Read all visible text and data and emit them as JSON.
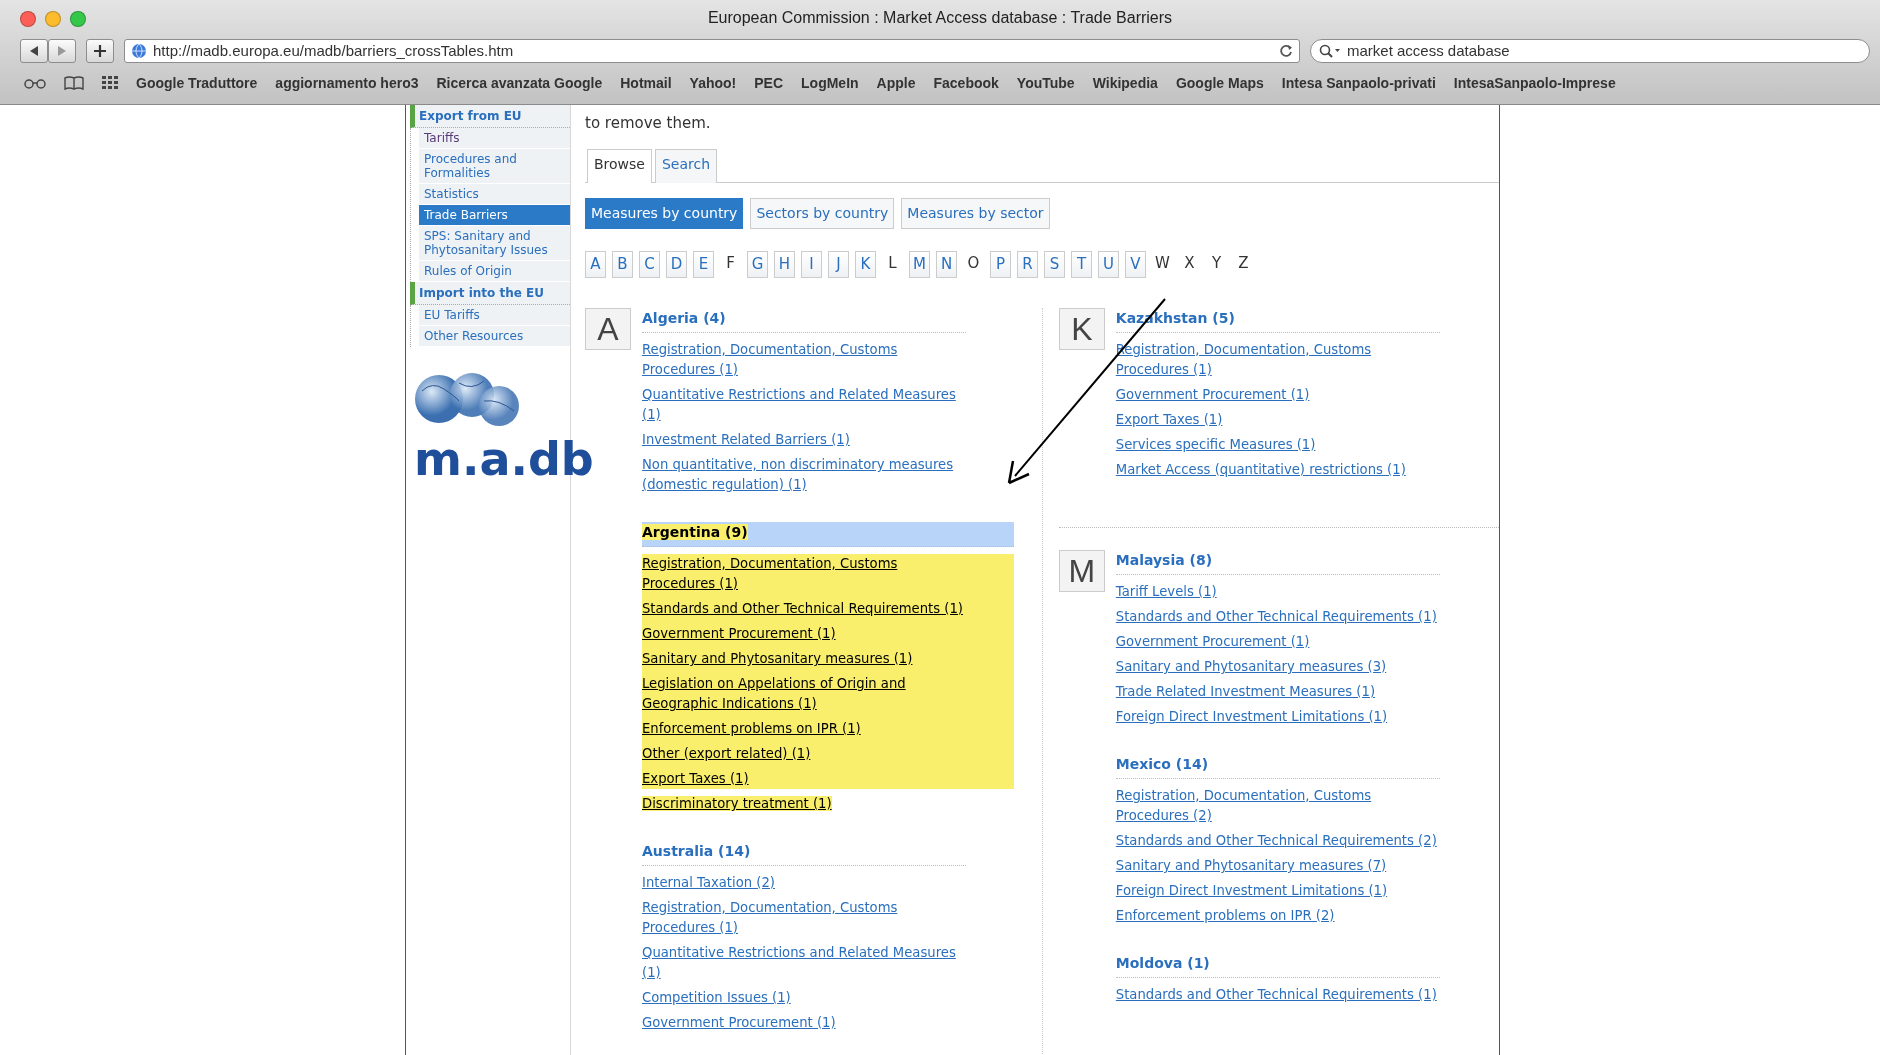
{
  "window": {
    "title": "European Commission : Market Access database : Trade Barriers"
  },
  "toolbar": {
    "url": "http://madb.europa.eu/madb/barriers_crossTables.htm",
    "search": "market access database"
  },
  "bookmarks": [
    "Google Traduttore",
    "aggiornamento hero3",
    "Ricerca avanzata Google",
    "Hotmail",
    "Yahoo!",
    "PEC",
    "LogMeIn",
    "Apple",
    "Facebook",
    "YouTube",
    "Wikipedia",
    "Google Maps",
    "Intesa Sanpaolo-privati",
    "IntesaSanpaolo-Imprese"
  ],
  "sidebar": {
    "sections": [
      {
        "title": "Export from EU",
        "items": [
          {
            "label": "Tariffs",
            "selected": false,
            "visited": true
          },
          {
            "label": "Procedures and Formalities",
            "selected": false,
            "visited": false
          },
          {
            "label": "Statistics",
            "selected": false,
            "visited": false
          },
          {
            "label": "Trade Barriers",
            "selected": true,
            "visited": false
          },
          {
            "label": "SPS: Sanitary and Phytosanitary Issues",
            "selected": false,
            "visited": false
          },
          {
            "label": "Rules of Origin",
            "selected": false,
            "visited": false
          }
        ]
      },
      {
        "title": "Import into the EU",
        "items": [
          {
            "label": "EU Tariffs",
            "selected": false,
            "visited": false
          },
          {
            "label": "Other Resources",
            "selected": false,
            "visited": false
          }
        ]
      }
    ],
    "logo": "m.a.db"
  },
  "intro": "to remove them.",
  "tabs": [
    {
      "label": "Browse",
      "selected": true
    },
    {
      "label": "Search",
      "selected": false
    }
  ],
  "views": [
    {
      "label": "Measures by country",
      "selected": true
    },
    {
      "label": "Sectors by country",
      "selected": false
    },
    {
      "label": "Measures by sector",
      "selected": false
    }
  ],
  "letters": [
    {
      "label": "A",
      "link": true
    },
    {
      "label": "B",
      "link": true
    },
    {
      "label": "C",
      "link": true
    },
    {
      "label": "D",
      "link": true
    },
    {
      "label": "E",
      "link": true
    },
    {
      "label": "F",
      "link": false
    },
    {
      "label": "G",
      "link": true
    },
    {
      "label": "H",
      "link": true
    },
    {
      "label": "I",
      "link": true
    },
    {
      "label": "J",
      "link": true
    },
    {
      "label": "K",
      "link": true
    },
    {
      "label": "L",
      "link": false
    },
    {
      "label": "M",
      "link": true
    },
    {
      "label": "N",
      "link": true
    },
    {
      "label": "O",
      "link": false
    },
    {
      "label": "P",
      "link": true
    },
    {
      "label": "R",
      "link": true
    },
    {
      "label": "S",
      "link": true
    },
    {
      "label": "T",
      "link": true
    },
    {
      "label": "U",
      "link": true
    },
    {
      "label": "V",
      "link": true
    },
    {
      "label": "W",
      "link": false
    },
    {
      "label": "X",
      "link": false
    },
    {
      "label": "Y",
      "link": false
    },
    {
      "label": "Z",
      "link": false
    }
  ],
  "columns": [
    {
      "groups": [
        {
          "letter": "A",
          "countries": [
            {
              "name": "Algeria (4)",
              "highlighted": false,
              "measures": [
                "Registration, Documentation, Customs Procedures (1)",
                "Quantitative Restrictions and Related Measures (1)",
                "Investment Related Barriers (1)",
                "Non quantitative, non discriminatory measures (domestic regulation) (1)"
              ]
            },
            {
              "name": "Argentina (9)",
              "highlighted": true,
              "measures": [
                "Registration, Documentation, Customs Procedures (1)",
                "Standards and Other Technical Requirements (1)",
                "Government Procurement (1)",
                "Sanitary and Phytosanitary measures (1)",
                "Legislation on Appelations of Origin and Geographic Indications (1)",
                "Enforcement problems on IPR (1)",
                "Other (export related) (1)",
                "Export Taxes (1)",
                "Discriminatory treatment (1)"
              ]
            },
            {
              "name": "Australia (14)",
              "highlighted": false,
              "measures": [
                "Internal Taxation (2)",
                "Registration, Documentation, Customs Procedures (1)",
                "Quantitative Restrictions and Related Measures (1)",
                "Competition Issues (1)",
                "Government Procurement (1)"
              ]
            }
          ]
        }
      ]
    },
    {
      "groups": [
        {
          "letter": "K",
          "countries": [
            {
              "name": "Kazakhstan (5)",
              "highlighted": false,
              "measures": [
                "Registration, Documentation, Customs Procedures (1)",
                "Government Procurement (1)",
                "Export Taxes (1)",
                "Services specific Measures (1)",
                "Market Access (quantitative) restrictions (1)"
              ]
            }
          ]
        },
        {
          "letter": "M",
          "countries": [
            {
              "name": "Malaysia (8)",
              "highlighted": false,
              "measures": [
                "Tariff Levels (1)",
                "Standards and Other Technical Requirements (1)",
                "Government Procurement (1)",
                "Sanitary and Phytosanitary measures (3)",
                "Trade Related Investment Measures (1)",
                "Foreign Direct Investment Limitations (1)"
              ]
            },
            {
              "name": "Mexico (14)",
              "highlighted": false,
              "measures": [
                "Registration, Documentation, Customs Procedures (2)",
                "Standards and Other Technical Requirements (2)",
                "Sanitary and Phytosanitary measures (7)",
                "Foreign Direct Investment Limitations (1)",
                "Enforcement problems on IPR (2)"
              ]
            },
            {
              "name": "Moldova (1)",
              "highlighted": false,
              "measures": [
                "Standards and Other Technical Requirements (1)"
              ]
            }
          ]
        }
      ]
    }
  ]
}
